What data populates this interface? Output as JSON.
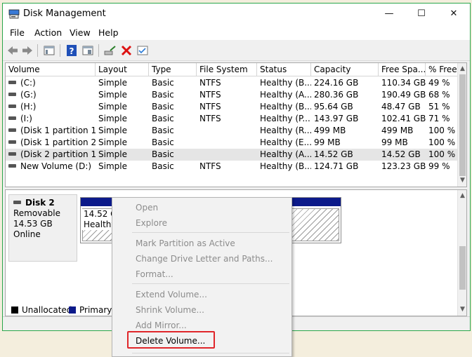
{
  "window": {
    "title": "Disk Management",
    "controls": {
      "minimize": "—",
      "maximize": "☐",
      "close": "✕"
    }
  },
  "menubar": [
    {
      "key": "file",
      "label": "File"
    },
    {
      "key": "action",
      "label": "Action"
    },
    {
      "key": "view",
      "label": "View"
    },
    {
      "key": "help",
      "label": "Help"
    }
  ],
  "toolbar": {
    "icons": [
      "back-arrow-icon",
      "forward-arrow-icon",
      "show-hide-console-tree-icon",
      "help-icon",
      "properties-icon",
      "connect-drive-icon",
      "delete-icon",
      "check-icon"
    ]
  },
  "volume_table": {
    "columns": [
      "Volume",
      "Layout",
      "Type",
      "File System",
      "Status",
      "Capacity",
      "Free Spa...",
      "% Free"
    ],
    "rows": [
      [
        "(C:)",
        "Simple",
        "Basic",
        "NTFS",
        "Healthy (B...",
        "224.16 GB",
        "110.34 GB",
        "49 %"
      ],
      [
        "(G:)",
        "Simple",
        "Basic",
        "NTFS",
        "Healthy (A...",
        "280.36 GB",
        "190.49 GB",
        "68 %"
      ],
      [
        "(H:)",
        "Simple",
        "Basic",
        "NTFS",
        "Healthy (B...",
        "95.64 GB",
        "48.47 GB",
        "51 %"
      ],
      [
        "(I:)",
        "Simple",
        "Basic",
        "NTFS",
        "Healthy (P...",
        "143.97 GB",
        "102.41 GB",
        "71 %"
      ],
      [
        "(Disk 1 partition 1)",
        "Simple",
        "Basic",
        "",
        "Healthy (R...",
        "499 MB",
        "499 MB",
        "100 %"
      ],
      [
        "(Disk 1 partition 2)",
        "Simple",
        "Basic",
        "",
        "Healthy (E...",
        "99 MB",
        "99 MB",
        "100 %"
      ],
      [
        "(Disk 2 partition 1)",
        "Simple",
        "Basic",
        "",
        "Healthy (A...",
        "14.52 GB",
        "14.52 GB",
        "100 %"
      ],
      [
        "New Volume (D:)",
        "Simple",
        "Basic",
        "NTFS",
        "Healthy (B...",
        "124.71 GB",
        "123.23 GB",
        "99 %"
      ]
    ],
    "selected_row": 6
  },
  "disk_panel": {
    "disk_name": "Disk 2",
    "disk_type": "Removable",
    "disk_size": "14.53 GB",
    "disk_state": "Online",
    "partition_size": "14.52 G",
    "partition_status": "Healthy"
  },
  "legend": {
    "unallocated": "Unallocated",
    "primary": "Primary p",
    "colors": {
      "unallocated": "#000000",
      "primary": "#0c1a8a"
    }
  },
  "context_menu": {
    "items": [
      {
        "label": "Open",
        "enabled": false
      },
      {
        "label": "Explore",
        "enabled": false
      },
      {
        "label": "Mark Partition as Active",
        "enabled": false
      },
      {
        "label": "Change Drive Letter and Paths...",
        "enabled": false
      },
      {
        "label": "Format...",
        "enabled": false
      },
      {
        "label": "Extend Volume...",
        "enabled": false
      },
      {
        "label": "Shrink Volume...",
        "enabled": false
      },
      {
        "label": "Add Mirror...",
        "enabled": false
      },
      {
        "label": "Delete Volume...",
        "enabled": true,
        "highlighted": true
      }
    ]
  },
  "colors": {
    "window_border": "#2aa64a",
    "partition_bar": "#0c1a8a",
    "highlight_box": "#e0262a"
  }
}
